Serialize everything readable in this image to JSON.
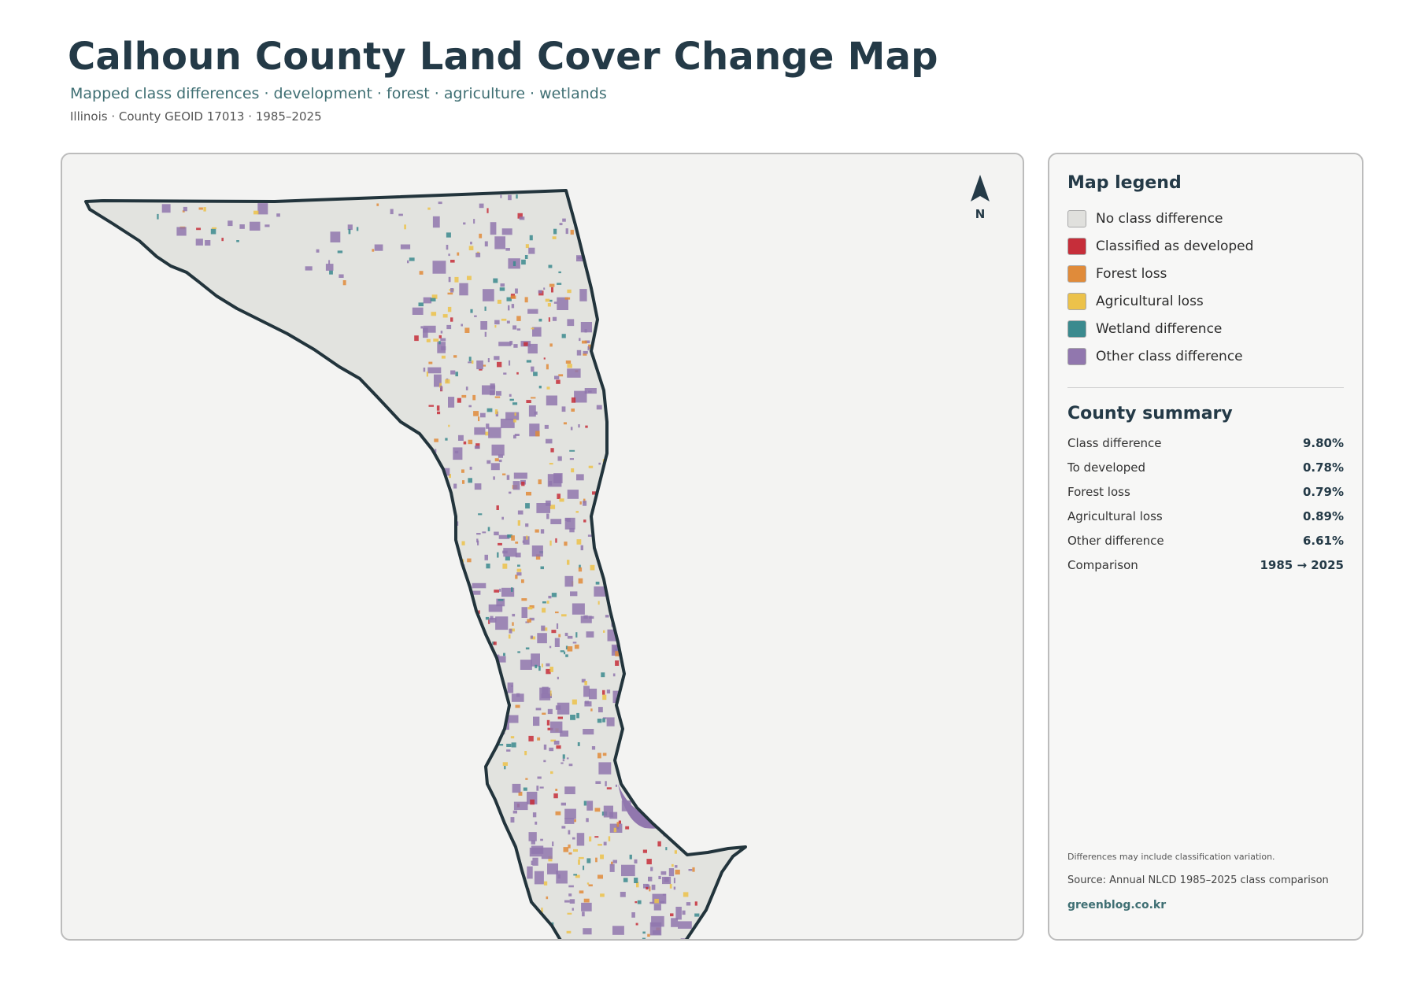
{
  "header": {
    "title": "Calhoun County Land Cover Change Map",
    "subtitle": "Mapped class differences · development · forest · agriculture · wetlands",
    "meta": "Illinois · County GEOID 17013 · 1985–2025"
  },
  "map": {
    "north_label": "N",
    "outline_color": "#22343c",
    "fill_color": "#e2e3df"
  },
  "legend": {
    "title": "Map legend",
    "items": [
      {
        "label": "No class difference",
        "color": "#e0e0dd"
      },
      {
        "label": "Classified as developed",
        "color": "#c62e3a"
      },
      {
        "label": "Forest loss",
        "color": "#e08b3a"
      },
      {
        "label": "Agricultural loss",
        "color": "#ecc24a"
      },
      {
        "label": "Wetland difference",
        "color": "#3b8a8e"
      },
      {
        "label": "Other class difference",
        "color": "#9177ae"
      }
    ]
  },
  "summary": {
    "title": "County summary",
    "rows": [
      {
        "label": "Class difference",
        "value": "9.80%"
      },
      {
        "label": "To developed",
        "value": "0.78%"
      },
      {
        "label": "Forest loss",
        "value": "0.79%"
      },
      {
        "label": "Agricultural loss",
        "value": "0.89%"
      },
      {
        "label": "Other difference",
        "value": "6.61%"
      },
      {
        "label": "Comparison",
        "value": "1985 → 2025"
      }
    ]
  },
  "footer": {
    "note": "Differences may include classification variation.",
    "source": "Source: Annual NLCD 1985–2025 class comparison",
    "credit": "greenblog.co.kr"
  }
}
